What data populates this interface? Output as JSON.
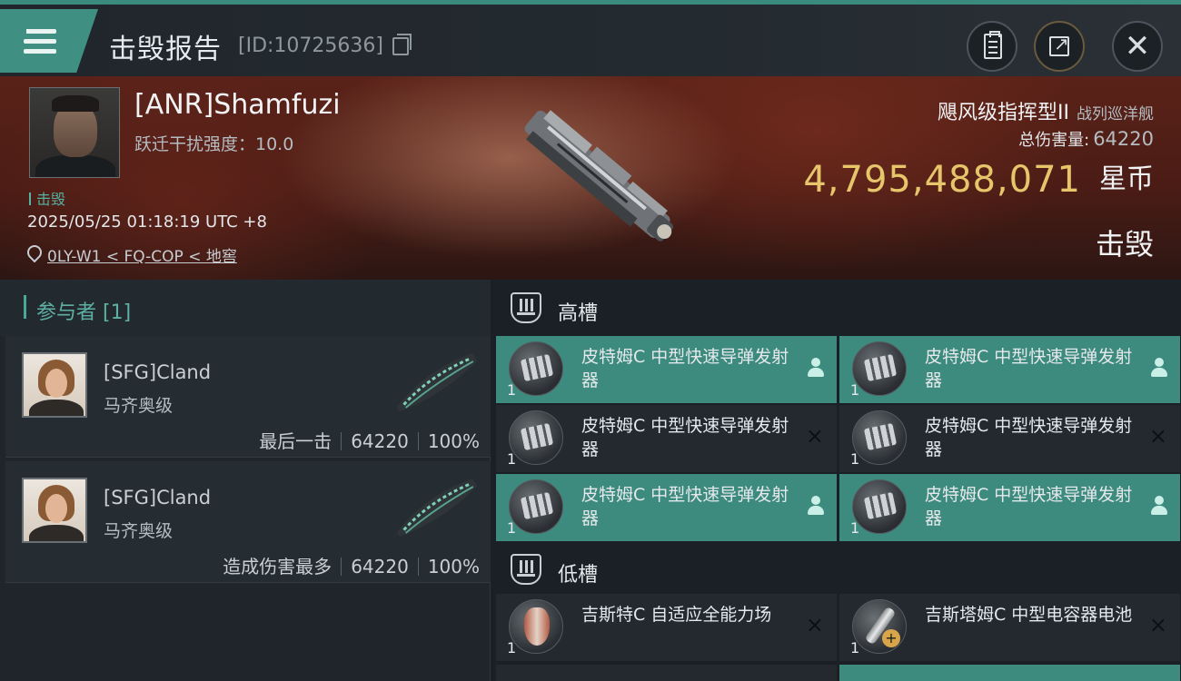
{
  "header": {
    "title": "击毁报告",
    "report_id": "[ID:10725636]"
  },
  "victim": {
    "name": "[ANR]Shamfuzi",
    "warp_strength": "跃迁干扰强度：10.0",
    "status_tag": "击毁",
    "datetime": "2025/05/25 01:18:19 UTC +8",
    "location": "0LY-W1 < FQ-COP < 地窖",
    "ship_name": "飓风级指挥型II",
    "ship_class": "战列巡洋舰",
    "total_damage_label": "总伤害量:",
    "total_damage": "64220",
    "isk_value": "4,795,488,071",
    "isk_unit": "星币",
    "result": "击毁"
  },
  "participants": {
    "header": "参与者 [1]",
    "items": [
      {
        "name": "[SFG]Cland",
        "ship": "马齐奥级",
        "role": "最后一击",
        "damage": "64220",
        "percent": "100%"
      },
      {
        "name": "[SFG]Cland",
        "ship": "马齐奥级",
        "role": "造成伤害最多",
        "damage": "64220",
        "percent": "100%"
      }
    ]
  },
  "fitting": {
    "high_slot_label": "高槽",
    "low_slot_label": "低槽",
    "high_slots": [
      {
        "name": "皮特姆C 中型快速导弹发射器",
        "qty": "1",
        "state": "dropped",
        "icon": "missile-launcher-icon"
      },
      {
        "name": "皮特姆C 中型快速导弹发射器",
        "qty": "1",
        "state": "dropped",
        "icon": "missile-launcher-icon"
      },
      {
        "name": "皮特姆C 中型快速导弹发射器",
        "qty": "1",
        "state": "destroyed",
        "icon": "missile-launcher-icon"
      },
      {
        "name": "皮特姆C 中型快速导弹发射器",
        "qty": "1",
        "state": "destroyed",
        "icon": "missile-launcher-icon"
      },
      {
        "name": "皮特姆C 中型快速导弹发射器",
        "qty": "1",
        "state": "dropped",
        "icon": "missile-launcher-icon"
      },
      {
        "name": "皮特姆C 中型快速导弹发射器",
        "qty": "1",
        "state": "dropped",
        "icon": "missile-launcher-icon"
      }
    ],
    "low_slots": [
      {
        "name": "吉斯特C 自适应全能力场",
        "qty": "1",
        "state": "destroyed",
        "icon": "adaptive-field-icon"
      },
      {
        "name": "吉斯塔姆C 中型电容器电池",
        "qty": "1",
        "state": "destroyed",
        "icon": "capacitor-battery-icon"
      }
    ]
  },
  "icons": {
    "dropped": "person-icon",
    "destroyed": "×"
  },
  "colors": {
    "accent_teal": "#3f8f82",
    "isk_gold": "#e6c56b",
    "dropped_bg": "#3d8a7e"
  }
}
